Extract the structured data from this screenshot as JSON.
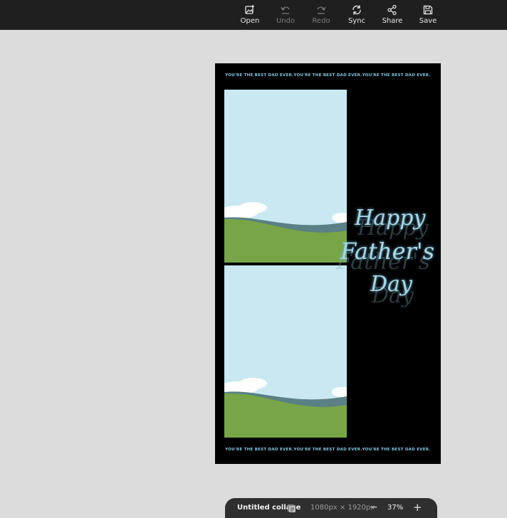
{
  "toolbar": {
    "items": [
      {
        "id": "open",
        "label": "Open",
        "icon": "image-add-icon",
        "enabled": true
      },
      {
        "id": "undo",
        "label": "Undo",
        "icon": "undo-icon",
        "enabled": false
      },
      {
        "id": "redo",
        "label": "Redo",
        "icon": "redo-icon",
        "enabled": false
      },
      {
        "id": "sync",
        "label": "Sync",
        "icon": "sync-icon",
        "enabled": true
      },
      {
        "id": "share",
        "label": "Share",
        "icon": "share-icon",
        "enabled": true
      },
      {
        "id": "save",
        "label": "Save",
        "icon": "save-icon",
        "enabled": true
      }
    ]
  },
  "collage": {
    "banner_text": "YOU'RE THE BEST DAD EVER.YOU'RE THE BEST DAD EVER.YOU'RE THE BEST DAD EVER.",
    "script_lines": [
      "Happy",
      "Father's",
      "Day"
    ],
    "colors": {
      "background": "#000000",
      "sky": "#c9e8f2",
      "hill": "#78a547",
      "water": "#5b8085",
      "accent": "#7fc6e0"
    }
  },
  "status": {
    "title": "Untitled collage",
    "page_icon": "pages-icon",
    "dimensions": "1080px × 1920px",
    "zoom_out": "−",
    "zoom": "37%",
    "zoom_in": "+"
  }
}
